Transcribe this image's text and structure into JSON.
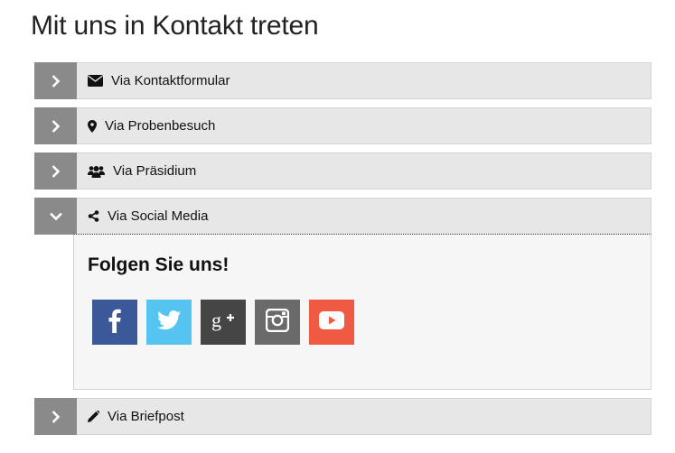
{
  "page": {
    "title": "Mit uns in Kontakt treten"
  },
  "accordion": {
    "items": [
      {
        "label": "Via Kontaktformular",
        "icon": "envelope-icon",
        "expanded": false
      },
      {
        "label": "Via Probenbesuch",
        "icon": "map-marker-icon",
        "expanded": false
      },
      {
        "label": "Via Präsidium",
        "icon": "users-icon",
        "expanded": false
      },
      {
        "label": "Via Social Media",
        "icon": "share-icon",
        "expanded": true
      },
      {
        "label": "Via Briefpost",
        "icon": "pencil-icon",
        "expanded": false
      }
    ],
    "social_panel": {
      "heading": "Folgen Sie uns!",
      "links": [
        {
          "name": "facebook",
          "icon": "facebook-icon",
          "color": "#3b5998"
        },
        {
          "name": "twitter",
          "icon": "twitter-icon",
          "color": "#55c4f0"
        },
        {
          "name": "google-plus",
          "icon": "google-plus-icon",
          "color": "#454545"
        },
        {
          "name": "instagram",
          "icon": "instagram-icon",
          "color": "#6a6a6a"
        },
        {
          "name": "youtube",
          "icon": "youtube-icon",
          "color": "#f05a43"
        }
      ]
    }
  },
  "colors": {
    "toggle_bg": "#8a8a8a",
    "header_bg": "#e7e7e7",
    "panel_bg": "#f6f6f6"
  }
}
